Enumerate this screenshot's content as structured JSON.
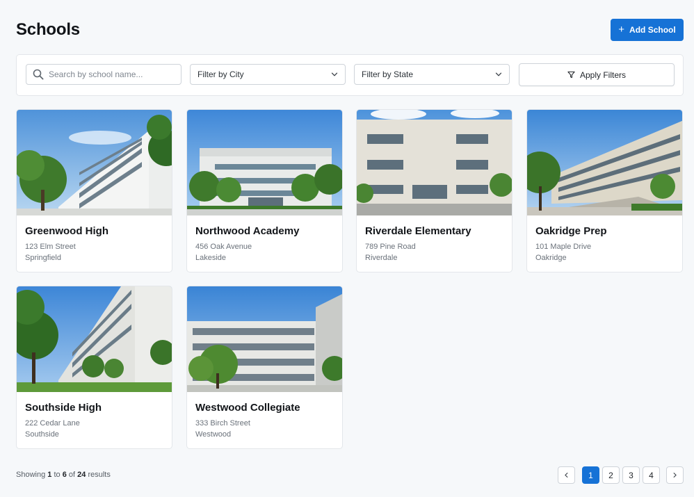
{
  "header": {
    "title": "Schools",
    "add_button_label": "Add School",
    "add_button_icon": "plus-icon",
    "accent_color": "#1672d6"
  },
  "filters": {
    "search_placeholder": "Search by school name...",
    "search_value": "",
    "city_select_label": "Filter by City",
    "state_select_label": "Filter by State",
    "apply_label": "Apply Filters",
    "apply_icon": "filter-icon"
  },
  "schools": [
    {
      "name": "Greenwood High",
      "address": "123 Elm Street",
      "city": "Springfield",
      "image": "school-photo-greenwood"
    },
    {
      "name": "Northwood Academy",
      "address": "456 Oak Avenue",
      "city": "Lakeside",
      "image": "school-photo-northwood"
    },
    {
      "name": "Riverdale Elementary",
      "address": "789 Pine Road",
      "city": "Riverdale",
      "image": "school-photo-riverdale"
    },
    {
      "name": "Oakridge Prep",
      "address": "101 Maple Drive",
      "city": "Oakridge",
      "image": "school-photo-oakridge"
    },
    {
      "name": "Southside High",
      "address": "222 Cedar Lane",
      "city": "Southside",
      "image": "school-photo-southside"
    },
    {
      "name": "Westwood Collegiate",
      "address": "333 Birch Street",
      "city": "Westwood",
      "image": "school-photo-westwood"
    }
  ],
  "pagination": {
    "showing_prefix": "Showing",
    "from": "1",
    "to_word": "to",
    "to": "6",
    "of_word": "of",
    "total": "24",
    "suffix": "results",
    "pages": [
      "1",
      "2",
      "3",
      "4"
    ],
    "current_page": "1"
  }
}
